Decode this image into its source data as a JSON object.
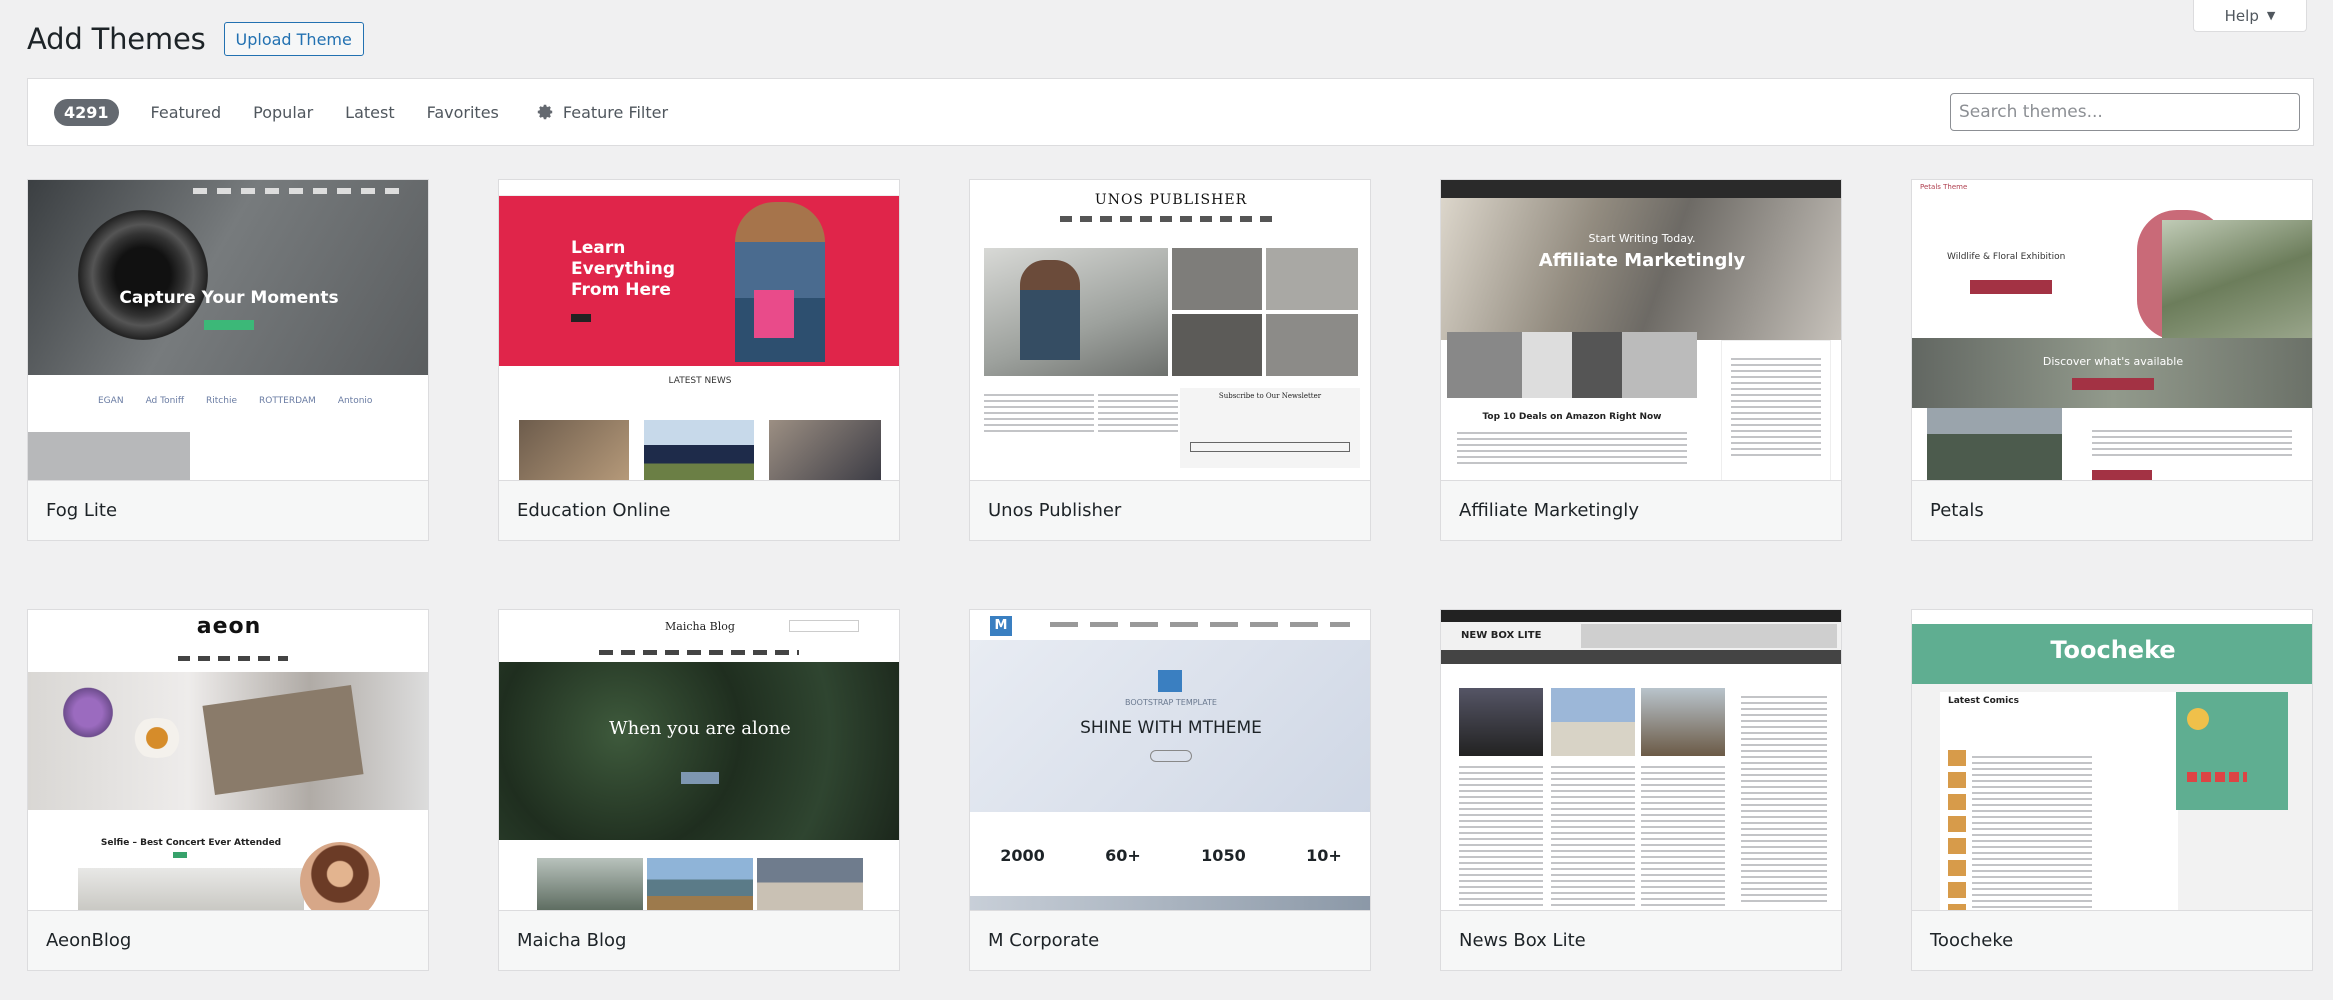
{
  "header": {
    "title": "Add Themes",
    "upload_label": "Upload Theme",
    "help_label": "Help"
  },
  "filters": {
    "count": "4291",
    "tabs": [
      "Featured",
      "Popular",
      "Latest",
      "Favorites"
    ],
    "feature_filter_label": "Feature Filter",
    "search_placeholder": "Search themes..."
  },
  "themes": [
    {
      "name": "Fog Lite",
      "preview": {
        "hero": "Capture Your Moments",
        "logos": [
          "EGAN",
          "Ad Toniff",
          "Ritchie",
          "ROTTERDAM",
          "Antonio"
        ]
      }
    },
    {
      "name": "Education Online",
      "preview": {
        "hero": "Learn Everything From Here",
        "section": "LATEST NEWS"
      }
    },
    {
      "name": "Unos Publisher",
      "preview": {
        "masthead": "UNOS PUBLISHER",
        "box": "Subscribe to Our Newsletter"
      }
    },
    {
      "name": "Affiliate Marketingly",
      "preview": {
        "kicker": "Start Writing Today.",
        "hero": "Affiliate Marketingly",
        "headline": "Top 10 Deals on Amazon Right Now"
      }
    },
    {
      "name": "Petals",
      "preview": {
        "logo": "Petals Theme",
        "event": "Wildlife & Floral Exhibition",
        "band": "Discover what's available"
      }
    },
    {
      "name": "AeonBlog",
      "preview": {
        "logo": "aeon",
        "post": "Selfie – Best Concert Ever Attended"
      }
    },
    {
      "name": "Maicha Blog",
      "preview": {
        "logo": "Maicha Blog",
        "hero": "When you are alone"
      }
    },
    {
      "name": "M Corporate",
      "preview": {
        "kicker": "BOOTSTRAP TEMPLATE",
        "hero": "SHINE WITH MTHEME",
        "stats": [
          "2000",
          "60+",
          "1050",
          "10+"
        ]
      }
    },
    {
      "name": "News Box Lite",
      "preview": {
        "logo": "NEW BOX LITE"
      }
    },
    {
      "name": "Toocheke",
      "preview": {
        "logo": "Toocheke",
        "section": "Latest Comics"
      }
    }
  ],
  "colors": {
    "accent": "#2271b1",
    "badge": "#646970",
    "education_red": "#e0254a",
    "toocheke_green": "#5fae91"
  }
}
